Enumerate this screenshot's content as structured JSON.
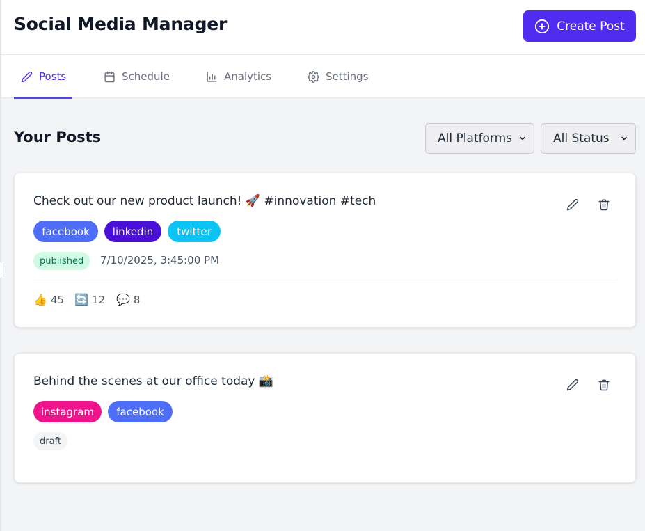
{
  "header": {
    "title": "Social Media Manager",
    "create_label": "Create Post"
  },
  "tabs": [
    {
      "label": "Posts",
      "icon": "pencil-icon",
      "active": true
    },
    {
      "label": "Schedule",
      "icon": "calendar-icon",
      "active": false
    },
    {
      "label": "Analytics",
      "icon": "bar-chart-icon",
      "active": false
    },
    {
      "label": "Settings",
      "icon": "gear-icon",
      "active": false
    }
  ],
  "main": {
    "section_title": "Your Posts",
    "filters": {
      "platform": "All Platforms",
      "status": "All Status"
    }
  },
  "colors": {
    "accent": "#4f2cf0",
    "facebook": "#4f6ef7",
    "linkedin": "#4b10d8",
    "twitter": "#0cc4f4",
    "instagram": "#f0148c",
    "published_bg": "#d1fae5",
    "published_text": "#047857",
    "draft_bg": "#f3f4f6",
    "draft_text": "#374151"
  },
  "posts": [
    {
      "content": "Check out our new product launch! 🚀 #innovation #tech",
      "platforms": [
        "facebook",
        "linkedin",
        "twitter"
      ],
      "status": "published",
      "timestamp": "7/10/2025, 3:45:00 PM",
      "stats": {
        "likes_icon": "👍",
        "likes": "45",
        "shares_icon": "🔄",
        "shares": "12",
        "comments_icon": "💬",
        "comments": "8"
      }
    },
    {
      "content": "Behind the scenes at our office today 📸",
      "platforms": [
        "instagram",
        "facebook"
      ],
      "status": "draft"
    }
  ]
}
